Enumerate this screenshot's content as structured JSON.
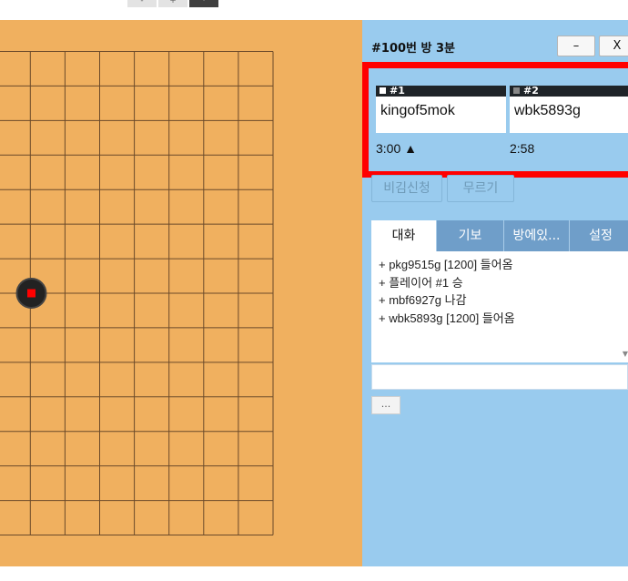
{
  "topbar": {
    "zoom_out_label": "-",
    "zoom_in_label": "+",
    "fit_label": "·"
  },
  "board": {
    "background_color": "#f0b05f",
    "line_color": "#6b4a2a",
    "stone": {
      "color": "black",
      "last_move_marker_color": "#ff0000",
      "icon": "black-stone-icon"
    }
  },
  "panel": {
    "room_title": "#100번 방   3분",
    "minimize_label": "–",
    "close_label": "X",
    "players": [
      {
        "number": "#1",
        "name": "kingof5mok",
        "time": "3:00 ▲",
        "marker_color": "#ffffff"
      },
      {
        "number": "#2",
        "name": "wbk5893g",
        "time": "2:58",
        "marker_color": "#888888"
      }
    ],
    "actions": {
      "draw_request": "비김신청",
      "undo": "무르기"
    },
    "tabs": [
      {
        "label": "대화",
        "active": true
      },
      {
        "label": "기보",
        "active": false
      },
      {
        "label": "방에있...",
        "active": false
      },
      {
        "label": "설정",
        "active": false
      }
    ],
    "chat_lines": [
      "+ pkg9515g [1200] 들어옴",
      "+ 플레이어 #1 승",
      "+ mbf6927g 나감",
      "+ wbk5893g [1200] 들어옴"
    ],
    "chat_input_value": "",
    "more_button": "..."
  },
  "colors": {
    "panel_bg": "#99cbee",
    "highlight_border": "#ff0000",
    "tab_bg": "#6f9ec9"
  }
}
